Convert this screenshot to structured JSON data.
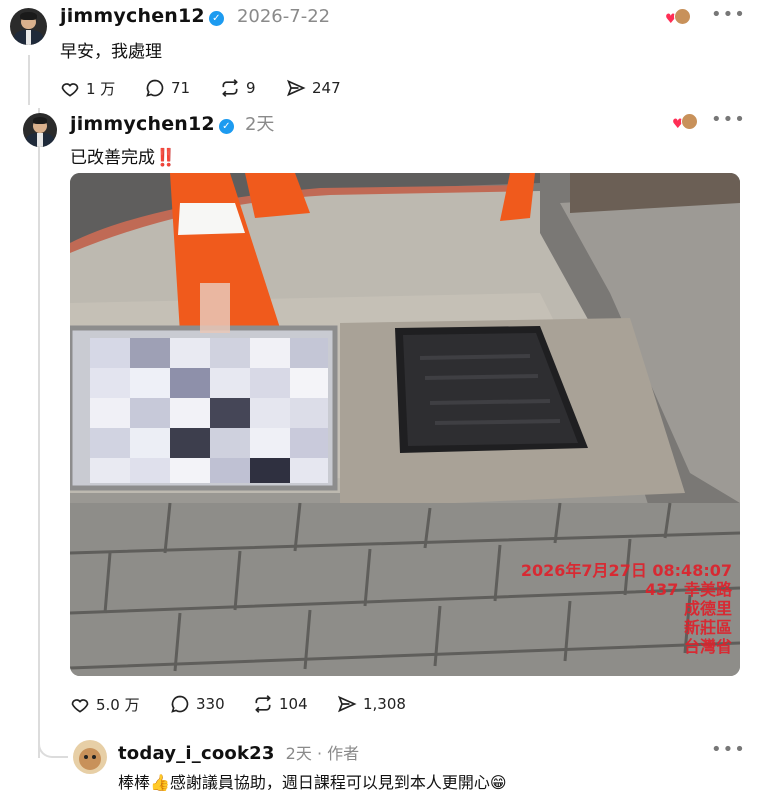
{
  "post": {
    "username": "jimmychen12",
    "time": "2026-7-22",
    "text": "早安，我處理",
    "likes": "1 万",
    "comments": "71",
    "reposts": "9",
    "shares": "247"
  },
  "reply": {
    "username": "jimmychen12",
    "time": "2天",
    "text": "已改善完成",
    "text_emoji": "‼️",
    "likes": "5.0 万",
    "comments": "330",
    "reposts": "104",
    "shares": "1,308",
    "photo_stamp": {
      "datetime": "2026年7月27日 08:48:07",
      "line2": "437 幸美路",
      "line3": "成德里",
      "line4": "新莊區",
      "line5": "台灣省"
    }
  },
  "comment": {
    "username": "today_i_cook23",
    "time": "2天",
    "author_tag": "· 作者",
    "text": "棒棒👍感謝議員協助，週日課程可以見到本人更開心😁"
  },
  "icons": [
    "verified-badge-icon",
    "heart-icon",
    "comment-icon",
    "repost-icon",
    "share-icon",
    "more-icon"
  ],
  "colors": {
    "verified": "#1d9bf0",
    "stamp": "#e0202a",
    "heart_reaction": "#ff2e55"
  }
}
